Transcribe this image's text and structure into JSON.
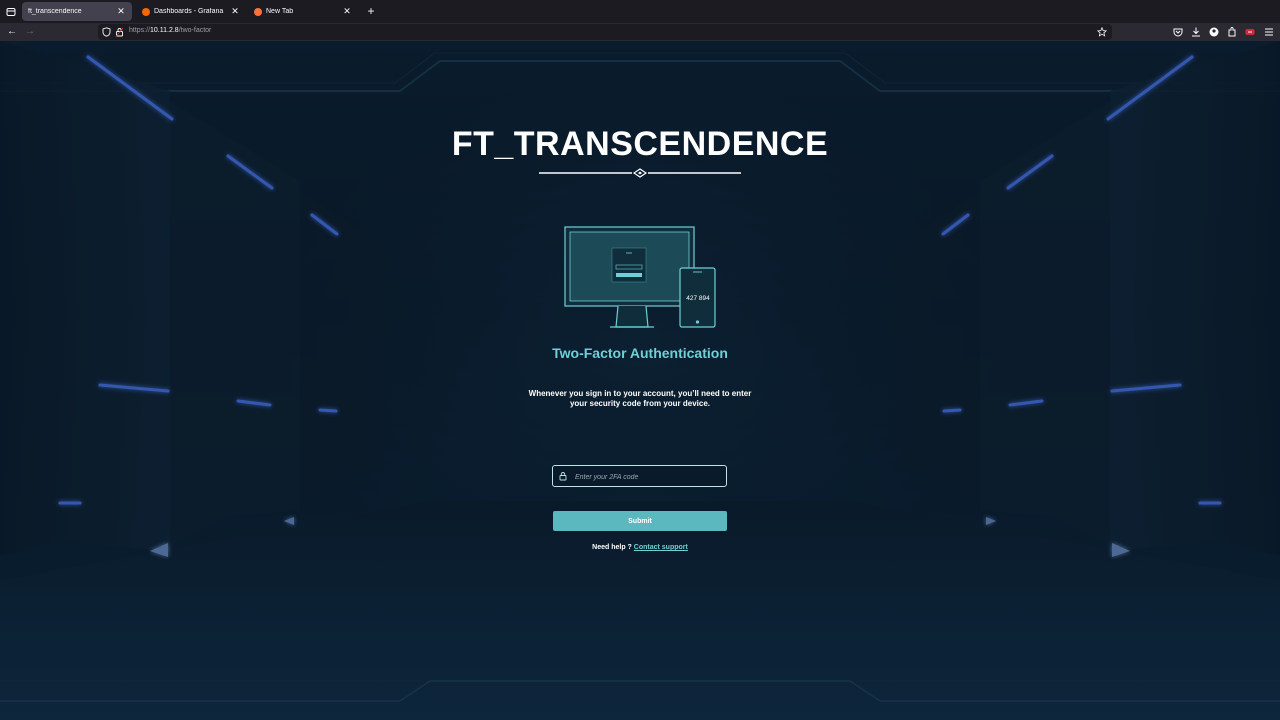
{
  "browser": {
    "tabs": [
      {
        "label": "ft_transcendence",
        "active": true,
        "favicon_color": "#3a3944"
      },
      {
        "label": "Dashboards - Grafana",
        "active": false,
        "favicon_color": "#f46800"
      },
      {
        "label": "New Tab",
        "active": false,
        "favicon_color": "#ff7139"
      }
    ],
    "url_prefix": "https://",
    "url_host": "10.11.2.8",
    "url_path": "/two-factor",
    "icons": [
      "tab-overview-icon",
      "back-icon",
      "forward-icon",
      "shield-icon",
      "lock-icon",
      "bookmark-star-icon",
      "pocket-icon",
      "downloads-icon",
      "account-icon",
      "extensions-icon",
      "extension-badge-icon",
      "menu-icon"
    ]
  },
  "page": {
    "title": "FT_TRANSCENDENCE",
    "illustration": {
      "phone_code": "427 894"
    },
    "subtitle": "Two-Factor Authentication",
    "description": "Whenever you sign in to your account, you’ll need to enter your security code from your device.",
    "code_input": {
      "placeholder": "Enter your 2FA code",
      "value": ""
    },
    "submit_label": "Submit",
    "help_text": "Need help ?",
    "help_link": "Contact support",
    "colors": {
      "accent": "#6fd0d8",
      "button": "#5ab8be",
      "neon": "#3d6bff"
    }
  }
}
